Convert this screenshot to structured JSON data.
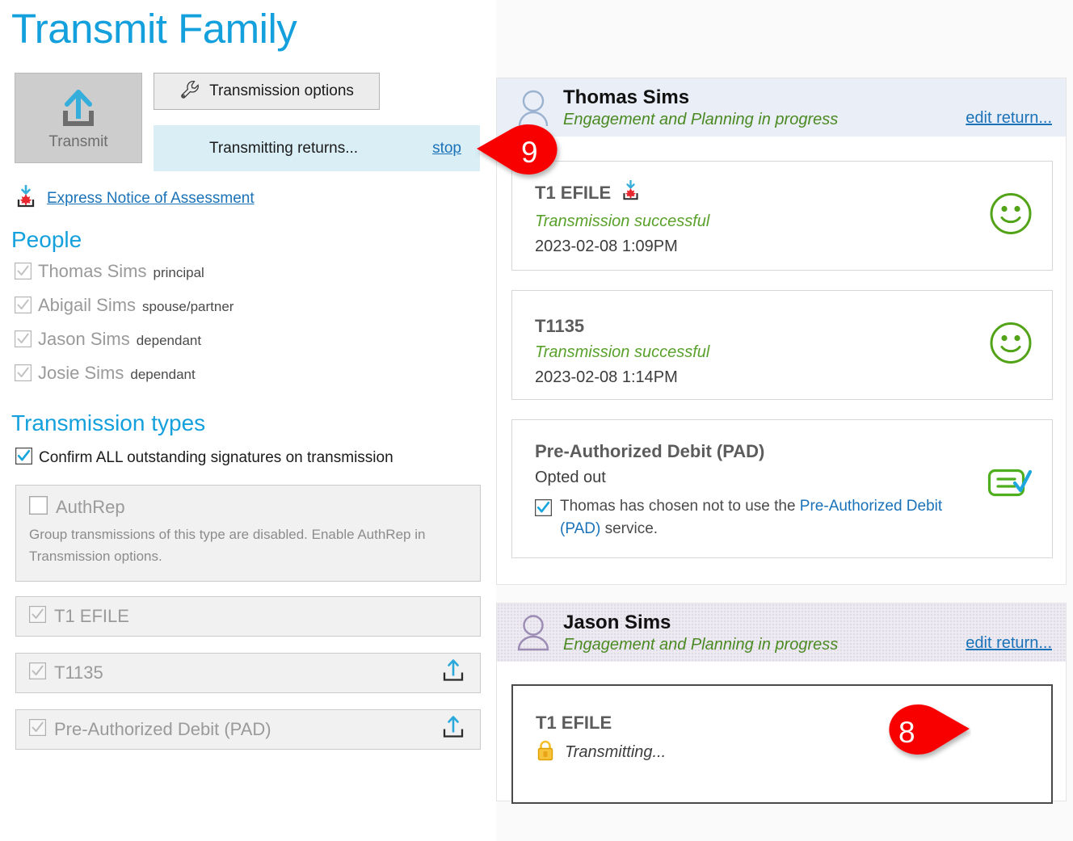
{
  "page": {
    "title": "Transmit Family"
  },
  "colors": {
    "accent_blue": "#14A0DC",
    "link_blue": "#1A72B8",
    "success_green": "#59A12A",
    "status_green": "#4B8A22",
    "callout_red": "#F80000",
    "lock_yellow": "#F5BE2B",
    "avatar_purple": "#9C8CB4",
    "avatar_blue": "#9BB3D0"
  },
  "toolbar": {
    "transmit_label": "Transmit",
    "transmit_icon": "upload-arrow-icon",
    "options_label": "Transmission options",
    "options_icon": "wrench-icon",
    "progress_text": "Transmitting returns...",
    "stop_label": "stop",
    "express_notice_label": "Express Notice of Assessment",
    "express_notice_icon": "download-maple-leaf-icon"
  },
  "people": {
    "heading": "People",
    "items": [
      {
        "name": "Thomas Sims",
        "role": "principal",
        "checked": true
      },
      {
        "name": "Abigail Sims",
        "role": "spouse/partner",
        "checked": true
      },
      {
        "name": "Jason Sims",
        "role": "dependant",
        "checked": true
      },
      {
        "name": "Josie Sims",
        "role": "dependant",
        "checked": true
      }
    ]
  },
  "transmission_types": {
    "heading": "Transmission types",
    "confirm_signatures_label": "Confirm ALL outstanding signatures on transmission",
    "confirm_signatures_checked": true,
    "items": [
      {
        "label": "AuthRep",
        "checked": false,
        "disabled": true,
        "description": "Group transmissions of this type are disabled. Enable AuthRep in Transmission options.",
        "upload": false
      },
      {
        "label": "T1 EFILE",
        "checked": true,
        "disabled": true,
        "description": "",
        "upload": false
      },
      {
        "label": "T1135",
        "checked": true,
        "disabled": true,
        "description": "",
        "upload": true
      },
      {
        "label": "Pre-Authorized Debit (PAD)",
        "checked": true,
        "disabled": true,
        "description": "",
        "upload": true
      }
    ]
  },
  "clients": [
    {
      "name": "Thomas Sims",
      "status": "Engagement and Planning in progress",
      "edit_link": "edit return...",
      "avatar_icon": "person-head-circle-icon",
      "returns": [
        {
          "title": "T1 EFILE",
          "title_icon": "download-maple-leaf-icon",
          "status": "Transmission successful",
          "timestamp": "2023-02-08 1:09PM",
          "result_icon": "smiley-face-icon"
        },
        {
          "title": "T1135",
          "title_icon": "",
          "status": "Transmission successful",
          "timestamp": "2023-02-08 1:14PM",
          "result_icon": "smiley-face-icon"
        },
        {
          "title": "Pre-Authorized Debit (PAD)",
          "title_icon": "",
          "status": "Opted out",
          "note_checked": true,
          "note_text_1": "Thomas has chosen not to use the ",
          "note_link": "Pre-Authorized Debit (PAD)",
          "note_text_2": " service.",
          "result_icon": "form-check-icon"
        }
      ]
    },
    {
      "name": "Jason Sims",
      "status": "Engagement and Planning in progress",
      "edit_link": "edit return...",
      "avatar_icon": "person-silhouette-icon",
      "returns": [
        {
          "title": "T1 EFILE",
          "title_icon": "",
          "status": "Transmitting...",
          "status_icon": "lock-icon",
          "result_icon": "loading-spinner-icon"
        }
      ]
    }
  ],
  "callouts": [
    {
      "number": "9",
      "direction": "left"
    },
    {
      "number": "8",
      "direction": "right"
    }
  ]
}
